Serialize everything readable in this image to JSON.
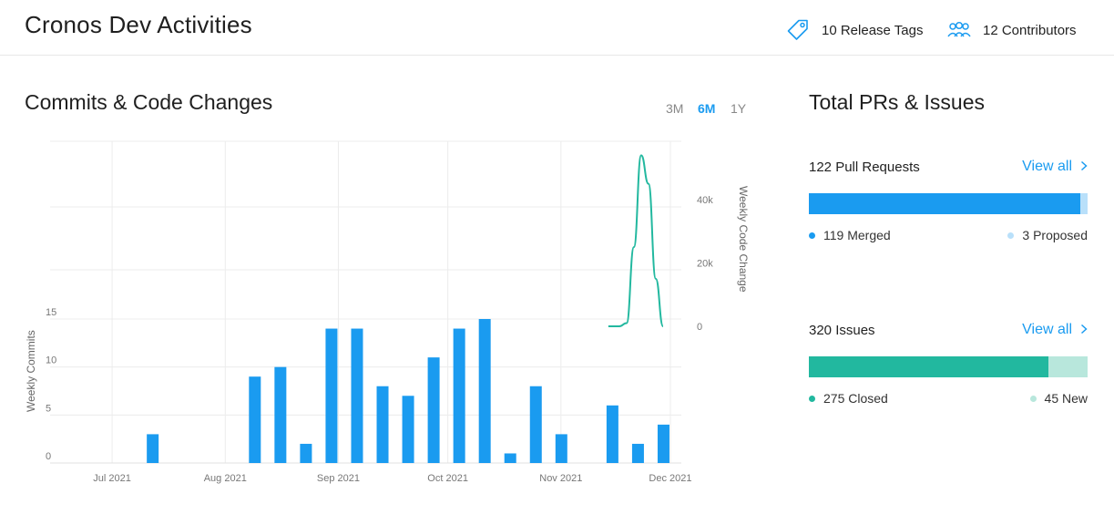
{
  "app": {
    "title": "Cronos Dev Activities"
  },
  "header": {
    "release_tags": "10 Release Tags",
    "contributors": "12 Contributors",
    "tag_icon": "tag-icon",
    "contributors_icon": "people-icon"
  },
  "commits": {
    "title": "Commits & Code Changes",
    "ranges": [
      "3M",
      "6M",
      "1Y"
    ],
    "active_range": "6M"
  },
  "prs": {
    "title": "Total PRs & Issues",
    "pull_requests": {
      "label": "122 Pull Requests",
      "view_all": "View all",
      "merged_label": "119 Merged",
      "proposed_label": "3 Proposed",
      "merged": 119,
      "proposed": 3
    },
    "issues": {
      "label": "320 Issues",
      "view_all": "View all",
      "closed_label": "275 Closed",
      "new_label": "45 New",
      "closed": 275,
      "new": 45
    },
    "colors": {
      "merged": "#1a9bf0",
      "proposed": "#b9e0fa",
      "closed": "#22b89f",
      "new": "#b8e7dc"
    }
  },
  "chart_data": {
    "type": "bar",
    "x_ticks": [
      "Jul 2021",
      "Aug 2021",
      "Sep 2021",
      "Oct 2021",
      "Nov 2021",
      "Dec 2021"
    ],
    "weeks": [
      "2021-06-20",
      "2021-06-27",
      "2021-07-04",
      "2021-07-11",
      "2021-07-18",
      "2021-07-25",
      "2021-08-01",
      "2021-08-08",
      "2021-08-15",
      "2021-08-22",
      "2021-08-29",
      "2021-09-05",
      "2021-09-12",
      "2021-09-19",
      "2021-09-26",
      "2021-10-03",
      "2021-10-10",
      "2021-10-17",
      "2021-10-24",
      "2021-10-31",
      "2021-11-07",
      "2021-11-14",
      "2021-11-21",
      "2021-11-28"
    ],
    "series": [
      {
        "name": "Weekly Commits",
        "type": "bar",
        "color": "#1a9bf0",
        "values": [
          0,
          0,
          0,
          3,
          0,
          0,
          0,
          9,
          10,
          2,
          14,
          14,
          8,
          7,
          11,
          14,
          15,
          1,
          8,
          3,
          0,
          6,
          2,
          4
        ]
      },
      {
        "name": "Weekly Code Change",
        "type": "line",
        "color": "#22b89f",
        "x": [
          "2021-11-14",
          "2021-11-17",
          "2021-11-19",
          "2021-11-21",
          "2021-11-23",
          "2021-11-25",
          "2021-11-27",
          "2021-11-29"
        ],
        "values": [
          0,
          0,
          1000,
          25000,
          54000,
          45000,
          15000,
          0
        ]
      }
    ],
    "ylabel_left": "Weekly Commits",
    "ylabel_right": "Weekly Code Change",
    "y_left_ticks": [
      "0",
      "5",
      "10",
      "15"
    ],
    "y_left_lim": [
      0,
      15
    ],
    "y_right_ticks": [
      "0",
      "20k",
      "40k"
    ],
    "y_right_lim": [
      0,
      40000
    ],
    "grid": true
  }
}
